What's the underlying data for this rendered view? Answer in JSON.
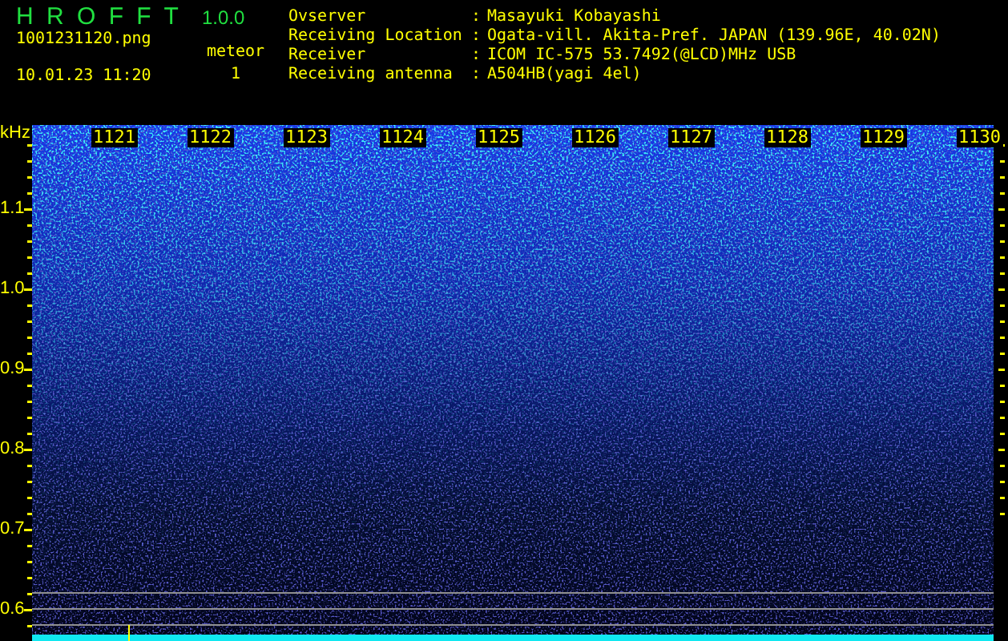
{
  "app": {
    "name": "H R O F F T",
    "version": "1.0.0"
  },
  "file": {
    "name": "1001231120.png",
    "datetime": "10.01.23 11:20"
  },
  "meteor": {
    "label": "meteor",
    "count": "1"
  },
  "info": [
    {
      "label": "Ovserver",
      "sep": ":",
      "value": "Masayuki Kobayashi"
    },
    {
      "label": "Receiving Location",
      "sep": ":",
      "value": "Ogata-vill. Akita-Pref. JAPAN (139.96E, 40.02N)"
    },
    {
      "label": "Receiver",
      "sep": ":",
      "value": "ICOM IC-575 53.7492(@LCD)MHz USB"
    },
    {
      "label": "Receiving antenna",
      "sep": ":",
      "value": "A504HB(yagi 4el)"
    }
  ],
  "spectrogram": {
    "unit": "kHz",
    "y_labels": [
      "1.1",
      "1.0",
      "0.9",
      "0.8",
      "0.7",
      "0.6"
    ],
    "time_labels": [
      "1121",
      "1122",
      "1123",
      "1124",
      "1125",
      "1126",
      "1127",
      "1128",
      "1129",
      "1130"
    ]
  }
}
